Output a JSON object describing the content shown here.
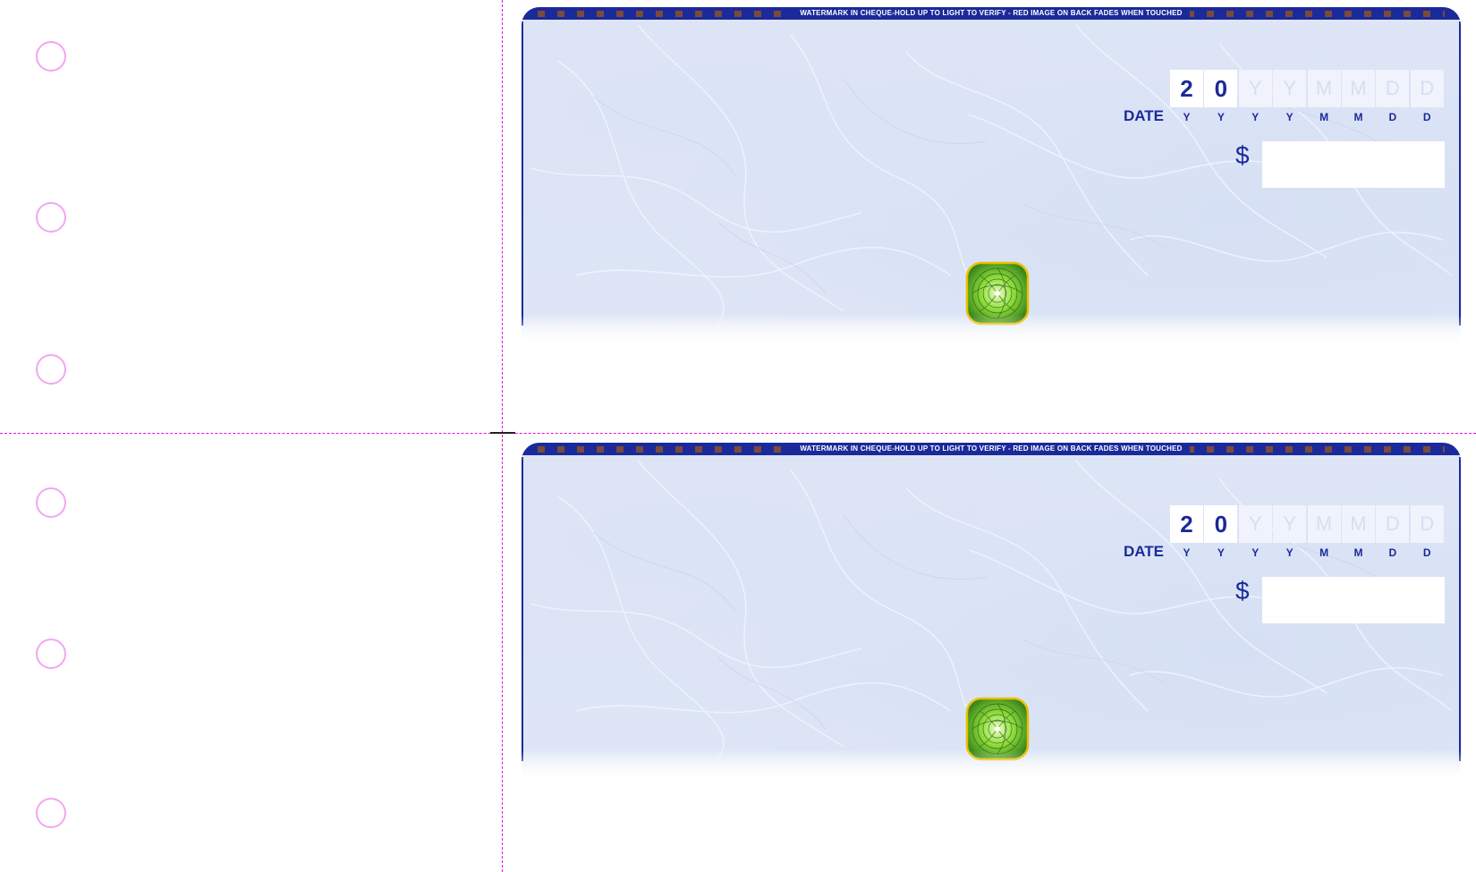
{
  "cheques": [
    {
      "banner": "WATERMARK IN CHEQUE-HOLD UP TO LIGHT TO VERIFY - RED IMAGE ON BACK FADES WHEN TOUCHED",
      "date_label": "DATE",
      "date_digits": [
        "2",
        "0",
        "Y",
        "Y",
        "M",
        "M",
        "D",
        "D"
      ],
      "date_format_letters": [
        "Y",
        "Y",
        "Y",
        "Y",
        "M",
        "M",
        "D",
        "D"
      ],
      "currency_symbol": "$"
    },
    {
      "banner": "WATERMARK IN CHEQUE-HOLD UP TO LIGHT TO VERIFY - RED IMAGE ON BACK FADES WHEN TOUCHED",
      "date_label": "DATE",
      "date_digits": [
        "2",
        "0",
        "Y",
        "Y",
        "M",
        "M",
        "D",
        "D"
      ],
      "date_format_letters": [
        "Y",
        "Y",
        "Y",
        "Y",
        "M",
        "M",
        "D",
        "D"
      ],
      "currency_symbol": "$"
    }
  ],
  "colors": {
    "ink": "#1a2a9a",
    "perforation": "#e010e0",
    "punch_hole": "#f2a6f2",
    "marble": "#dde5f6"
  },
  "icons": [
    "security-seal-icon"
  ]
}
